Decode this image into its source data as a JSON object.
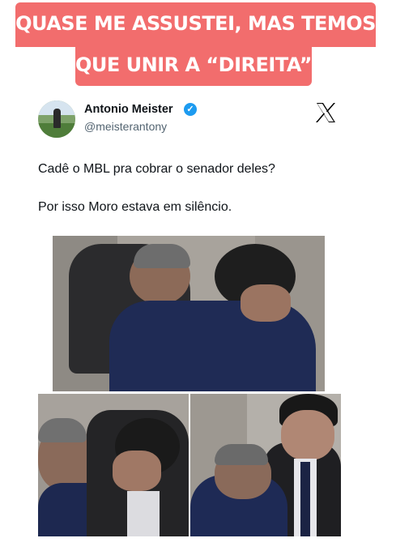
{
  "caption": {
    "line1": "QUASE ME ASSUSTEI, MAS TEMOS",
    "line2": "QUE UNIR A “DIREITA”",
    "background_color": "#f26d6d",
    "text_color": "#ffffff"
  },
  "tweet": {
    "author_name": "Antonio Meister",
    "author_handle": "@meisterantony",
    "verified_icon": "verified-badge-icon",
    "platform_icon": "x-logo-icon",
    "text_lines": [
      "Cadê o MBL pra cobrar o senador deles?",
      "Por isso Moro estava em silêncio."
    ],
    "photos": [
      {
        "name": "hug-photo-top",
        "description_icon": "photo"
      },
      {
        "name": "hug-photo-bottom-left",
        "description_icon": "photo"
      },
      {
        "name": "smile-photo-bottom-right",
        "description_icon": "photo"
      }
    ]
  }
}
